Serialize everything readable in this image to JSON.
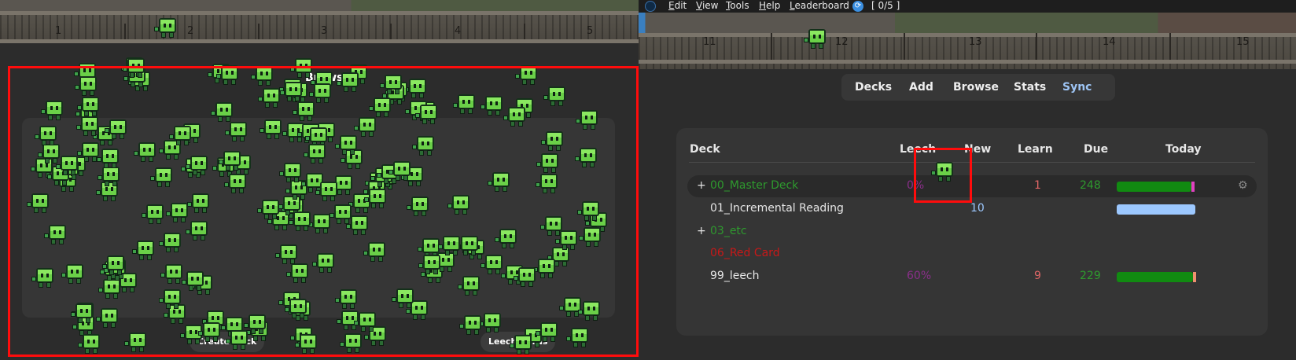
{
  "left": {
    "track_labels": [
      "1",
      "2",
      "3",
      "4",
      "5"
    ],
    "panel_title": "Browse",
    "buttons": [
      "Create Deck",
      "Leech Cards"
    ]
  },
  "right": {
    "menu": [
      {
        "label": "Edit",
        "u": "E",
        "rest": "dit"
      },
      {
        "label": "View",
        "u": "V",
        "rest": "iew"
      },
      {
        "label": "Tools",
        "u": "T",
        "rest": "ools"
      },
      {
        "label": "Help",
        "u": "H",
        "rest": "elp"
      },
      {
        "label": "Leaderboard",
        "u": "L",
        "rest": "eaderboard"
      }
    ],
    "sync_icon": "sync-icon",
    "counter": "[ 0/5 ]",
    "track_labels": [
      "11",
      "12",
      "13",
      "14",
      "15"
    ],
    "tabs": [
      "Decks",
      "Add",
      "Browse",
      "Stats",
      "Sync"
    ],
    "headers": {
      "deck": "Deck",
      "leech": "Leech",
      "new": "New",
      "learn": "Learn",
      "due": "Due",
      "today": "Today"
    },
    "rows": [
      {
        "expand": "+",
        "name": "00_Master Deck",
        "name_color": "#2e9a2e",
        "leech": "0%",
        "new": "",
        "learn": "1",
        "due": "248",
        "today": {
          "fill": 0.95,
          "color": "#118a11",
          "end": "#e040c0"
        },
        "selected": true
      },
      {
        "expand": "",
        "name": "01_Incremental Reading",
        "name_color": "#e6e6e6",
        "leech": "",
        "new": "10",
        "learn": "",
        "due": "",
        "today": {
          "fill": 1.0,
          "color": "#9cc8ff",
          "end": ""
        },
        "selected": false
      },
      {
        "expand": "+",
        "name": "03_etc",
        "name_color": "#2e9a2e",
        "leech": "",
        "new": "",
        "learn": "",
        "due": "",
        "today": null,
        "selected": false
      },
      {
        "expand": "",
        "name": "06_Red Card",
        "name_color": "#c81818",
        "leech": "",
        "new": "",
        "learn": "",
        "due": "",
        "today": null,
        "selected": false
      },
      {
        "expand": "",
        "name": "99_leech",
        "name_color": "#e6e6e6",
        "leech": "60%",
        "new": "",
        "learn": "9",
        "due": "229",
        "today": {
          "fill": 0.97,
          "color": "#118a11",
          "end": "#f09070"
        },
        "selected": false
      }
    ]
  },
  "colors": {
    "highlight": "#ff0c0c",
    "learn": "#e06666",
    "due": "#2e9a2e",
    "new": "#9cc8ff",
    "leech": "#8a2f8a",
    "sprite": "#6ad048"
  }
}
